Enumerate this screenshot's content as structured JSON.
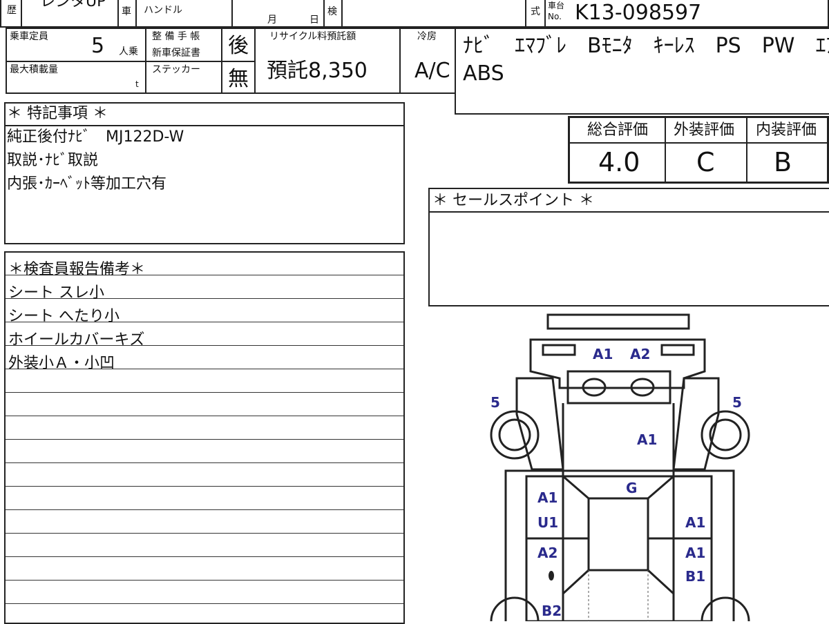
{
  "top_row": {
    "history_label": "歴",
    "model_fragment": "レンタUP",
    "car_label": "車",
    "handle_label": "ハンドル",
    "month_label": "月",
    "day_label": "日",
    "inspection_label": "検",
    "type_label": "式",
    "chassis_no_label_1": "車台",
    "chassis_no_label_2": "No.",
    "chassis_no": "K13-098597"
  },
  "row2": {
    "capacity_label": "乗車定員",
    "capacity_value": "5",
    "capacity_unit": "人乗",
    "max_load_label": "最大積載量",
    "max_load_unit": "t",
    "maint_label": "整 備 手 帳",
    "warranty_label": "新車保証書",
    "sticker_label": "ステッカー",
    "maint_mark": "後",
    "sticker_mark": "無",
    "recycle_label": "リサイクル料預託額",
    "recycle_value": "預託8,350",
    "ac_label": "冷房",
    "ac_value": "A/C",
    "equipment_line1": "ﾅﾋﾞ　ｴﾏﾌﾞﾚ　Bﾓﾆﾀ　ｷｰﾚｽ　PS　PW　ｴｱB",
    "equipment_line2": "ABS"
  },
  "ratings": {
    "overall_label": "総合評価",
    "exterior_label": "外装評価",
    "interior_label": "内装評価",
    "overall_value": "4.0",
    "exterior_value": "C",
    "interior_value": "B"
  },
  "special_notes": {
    "heading": "＊ 特記事項 ＊",
    "lines": [
      "純正後付ﾅﾋﾞ　MJ122D-W",
      "取説･ﾅﾋﾞ取説",
      "内張･ｶｰﾍﾞｯﾄ等加工穴有"
    ]
  },
  "sales_points": {
    "heading": "＊ セールスポイント ＊"
  },
  "inspector_report": {
    "heading": "＊検査員報告備考＊",
    "lines": [
      "シート スレ小",
      "シート へたり小",
      "ホイールカバーキズ",
      "外装小Ａ・小凹"
    ]
  },
  "damage_map": {
    "marks": [
      "A1",
      "A2",
      "5",
      "5",
      "A1",
      "G",
      "A1",
      "U1",
      "A1",
      "A2",
      "A1",
      "B1",
      "B2"
    ]
  },
  "colors": {
    "damage_mark": "#2a2a8c",
    "line": "#222222"
  }
}
